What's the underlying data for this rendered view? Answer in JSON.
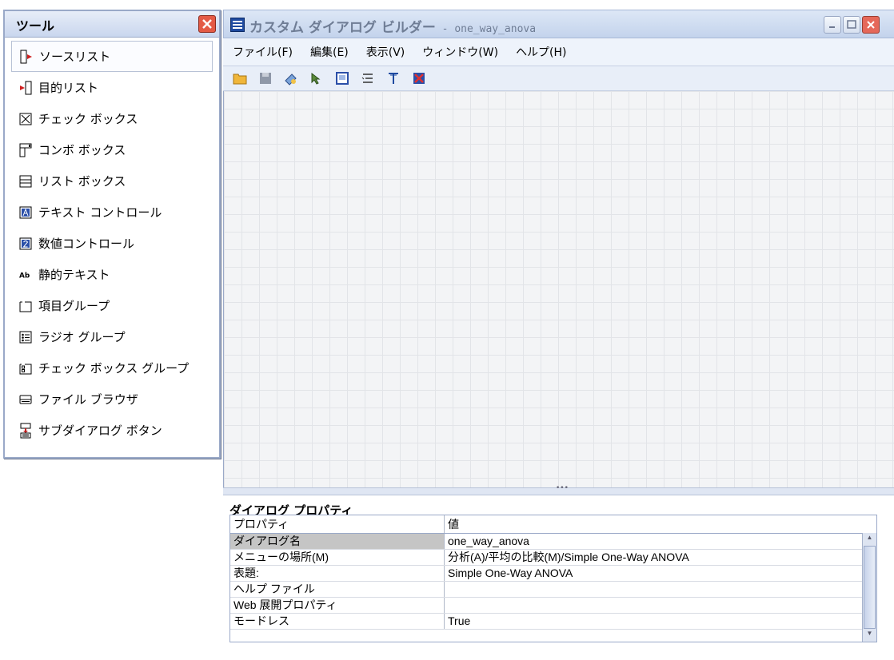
{
  "tools_panel": {
    "title": "ツール",
    "items": [
      {
        "label": "ソースリスト",
        "icon": "source-list-icon"
      },
      {
        "label": "目的リスト",
        "icon": "target-list-icon"
      },
      {
        "label": "チェック ボックス",
        "icon": "check-box-icon"
      },
      {
        "label": "コンボ ボックス",
        "icon": "combo-box-icon"
      },
      {
        "label": "リスト ボックス",
        "icon": "list-box-icon"
      },
      {
        "label": "テキスト コントロール",
        "icon": "text-control-icon"
      },
      {
        "label": "数値コントロール",
        "icon": "number-control-icon"
      },
      {
        "label": "静的テキスト",
        "icon": "static-text-icon"
      },
      {
        "label": "項目グループ",
        "icon": "item-group-icon"
      },
      {
        "label": "ラジオ グループ",
        "icon": "radio-group-icon"
      },
      {
        "label": "チェック ボックス グループ",
        "icon": "check-box-group-icon"
      },
      {
        "label": "ファイル ブラウザ",
        "icon": "file-browser-icon"
      },
      {
        "label": "サブダイアログ ボタン",
        "icon": "sub-dialog-button-icon"
      }
    ]
  },
  "window": {
    "title": "カスタム ダイアログ ビルダー",
    "subtitle": " - one_way_anova"
  },
  "menu": {
    "items": [
      "ファイル(F)",
      "編集(E)",
      "表示(V)",
      "ウィンドウ(W)",
      "ヘルプ(H)"
    ]
  },
  "toolbar": {
    "icons": [
      "open-folder-icon",
      "save-icon",
      "preview-icon",
      "install-icon",
      "properties-icon",
      "order-icon",
      "toggle-icon",
      "close-red-icon"
    ]
  },
  "properties": {
    "title": "ダイアログ プロパティ",
    "header": {
      "property": "プロパティ",
      "value": "値"
    },
    "rows": [
      {
        "property": "ダイアログ名",
        "value": "one_way_anova"
      },
      {
        "property": "メニューの場所(M)",
        "value": "分析(A)/平均の比較(M)/Simple One-Way ANOVA"
      },
      {
        "property": "表題:",
        "value": "Simple One-Way ANOVA"
      },
      {
        "property": "ヘルプ ファイル",
        "value": ""
      },
      {
        "property": "Web 展開プロパティ",
        "value": ""
      },
      {
        "property": "モードレス",
        "value": "True"
      }
    ]
  },
  "colors": {
    "accent": "#1e4aa0",
    "close_red": "#e45a45",
    "chrome": "#c9d6ee"
  }
}
